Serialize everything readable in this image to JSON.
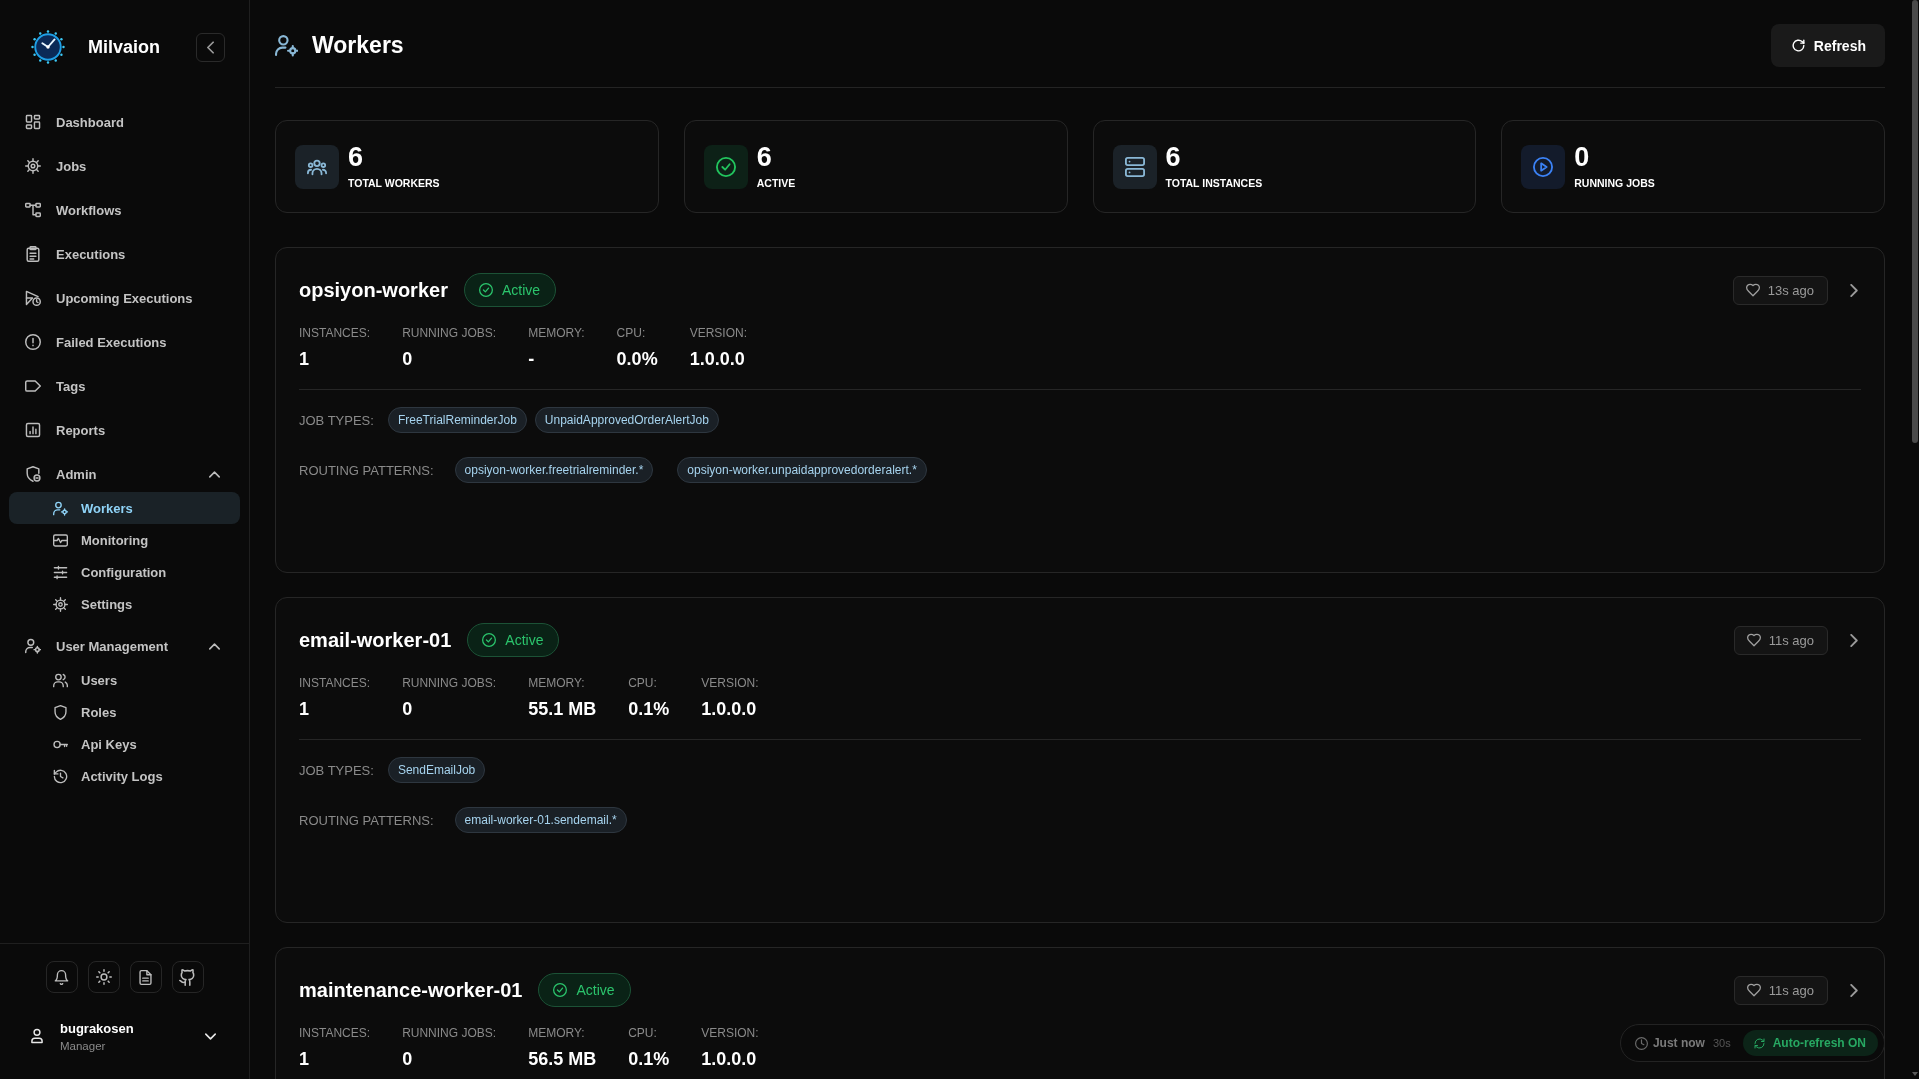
{
  "sidebar": {
    "brand": "Milvaion",
    "nav": [
      {
        "kind": "link",
        "label": "Dashboard",
        "selected": false
      },
      {
        "kind": "link",
        "label": "Jobs",
        "selected": false
      },
      {
        "kind": "link",
        "label": "Workflows",
        "selected": false
      },
      {
        "kind": "link",
        "label": "Executions",
        "selected": false
      },
      {
        "kind": "link",
        "label": "Upcoming Executions",
        "selected": false
      },
      {
        "kind": "link",
        "label": "Failed Executions",
        "selected": false
      },
      {
        "kind": "link",
        "label": "Tags",
        "selected": false
      },
      {
        "kind": "link",
        "label": "Reports",
        "selected": false
      },
      {
        "kind": "group",
        "label": "Admin",
        "selected": false,
        "expanded": true,
        "children": [
          {
            "label": "Workers",
            "selected": true
          },
          {
            "label": "Monitoring",
            "selected": false
          },
          {
            "label": "Configuration",
            "selected": false
          },
          {
            "label": "Settings",
            "selected": false
          }
        ]
      },
      {
        "kind": "group",
        "label": "User Management",
        "selected": false,
        "expanded": true,
        "children": [
          {
            "label": "Users",
            "selected": false
          },
          {
            "label": "Roles",
            "selected": false
          },
          {
            "label": "Api Keys",
            "selected": false
          },
          {
            "label": "Activity Logs",
            "selected": false
          }
        ]
      }
    ],
    "user": {
      "name": "bugrakosen",
      "role": "Manager"
    }
  },
  "header": {
    "title": "Workers",
    "refresh_button": "Refresh"
  },
  "stats": [
    {
      "value": "6",
      "label": "TOTAL WORKERS"
    },
    {
      "value": "6",
      "label": "ACTIVE"
    },
    {
      "value": "6",
      "label": "TOTAL INSTANCES"
    },
    {
      "value": "0",
      "label": "RUNNING JOBS"
    }
  ],
  "workers": [
    {
      "name": "opsiyon-worker",
      "status": "Active",
      "heartbeat": "13s ago",
      "metrics": [
        {
          "label": "INSTANCES:",
          "value": "1"
        },
        {
          "label": "RUNNING JOBS:",
          "value": "0"
        },
        {
          "label": "MEMORY:",
          "value": "-"
        },
        {
          "label": "CPU:",
          "value": "0.0%"
        },
        {
          "label": "VERSION:",
          "value": "1.0.0.0"
        }
      ],
      "job_types": {
        "label": "JOB TYPES:",
        "tags": [
          "FreeTrialReminderJob",
          "UnpaidApprovedOrderAlertJob"
        ]
      },
      "routing_patterns": {
        "label": "ROUTING PATTERNS:",
        "tags": [
          "opsiyon-worker.freetrialreminder.*",
          "opsiyon-worker.unpaidapprovedorderalert.*"
        ]
      }
    },
    {
      "name": "email-worker-01",
      "status": "Active",
      "heartbeat": "11s ago",
      "metrics": [
        {
          "label": "INSTANCES:",
          "value": "1"
        },
        {
          "label": "RUNNING JOBS:",
          "value": "0"
        },
        {
          "label": "MEMORY:",
          "value": "55.1 MB"
        },
        {
          "label": "CPU:",
          "value": "0.1%"
        },
        {
          "label": "VERSION:",
          "value": "1.0.0.0"
        }
      ],
      "job_types": {
        "label": "JOB TYPES:",
        "tags": [
          "SendEmailJob"
        ]
      },
      "routing_patterns": {
        "label": "ROUTING PATTERNS:",
        "tags": [
          "email-worker-01.sendemail.*"
        ]
      }
    },
    {
      "name": "maintenance-worker-01",
      "status": "Active",
      "heartbeat": "11s ago",
      "metrics": [
        {
          "label": "INSTANCES:",
          "value": "1"
        },
        {
          "label": "RUNNING JOBS:",
          "value": "0"
        },
        {
          "label": "MEMORY:",
          "value": "56.5 MB"
        },
        {
          "label": "CPU:",
          "value": "0.1%"
        },
        {
          "label": "VERSION:",
          "value": "1.0.0.0"
        }
      ]
    }
  ],
  "status_bar": {
    "updated": "Just now",
    "interval": "30s",
    "auto_refresh": {
      "label": "Auto-refresh ON",
      "on": true
    }
  }
}
